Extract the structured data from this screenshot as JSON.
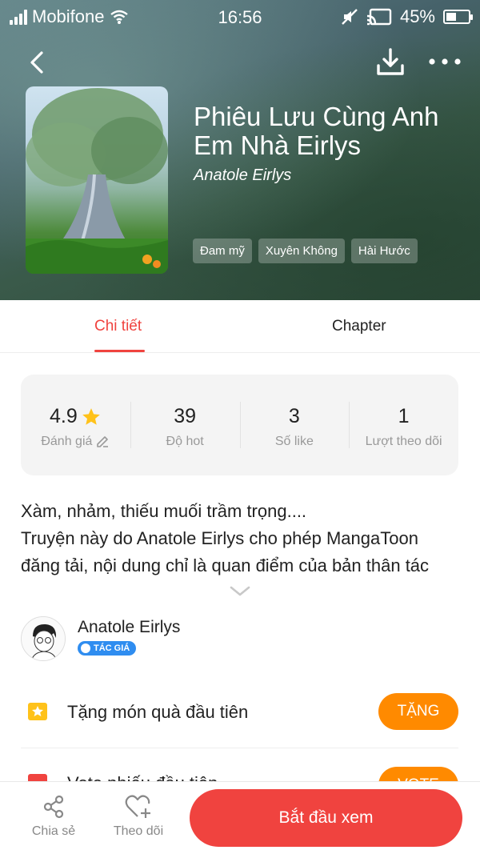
{
  "status_bar": {
    "carrier": "Mobifone",
    "time": "16:56",
    "battery": "45%",
    "battery_level": 0.45
  },
  "header": {
    "back_icon": "chevron-left-icon",
    "download_icon": "download-icon",
    "more_icon": "more-icon"
  },
  "book": {
    "title": "Phiêu Lưu Cùng Anh Em Nhà Eirlys",
    "author": "Anatole Eirlys",
    "tags": [
      "Đam mỹ",
      "Xuyên Không",
      "Hài Hước"
    ]
  },
  "tabs": [
    {
      "label": "Chi tiết",
      "active": true
    },
    {
      "label": "Chapter",
      "active": false
    }
  ],
  "stats": [
    {
      "value": "4.9",
      "label": "Đánh giá"
    },
    {
      "value": "39",
      "label": "Độ hot"
    },
    {
      "value": "3",
      "label": "Số like"
    },
    {
      "value": "1",
      "label": "Lượt theo dõi"
    }
  ],
  "description": "Xàm, nhảm, thiếu muối trầm trọng....\nTruyện này do Anatole Eirlys cho phép MangaToon đăng tải, nội dung chỉ là quan điểm của bản thân tác",
  "creator": {
    "name": "Anatole Eirlys",
    "badge": "TÁC GIÁ"
  },
  "gift": {
    "text": "Tặng món quà đầu tiên",
    "button": "TẶNG"
  },
  "vote": {
    "text": "Vote phiếu đầu tiên",
    "button": "VOTE"
  },
  "bottom_bar": {
    "share": "Chia sẻ",
    "follow": "Theo dõi",
    "start": "Bắt đầu xem"
  },
  "colors": {
    "accent": "#f0433f",
    "orange": "#ff8a00",
    "badge_blue": "#2f8df0",
    "star": "#ffc21a"
  }
}
